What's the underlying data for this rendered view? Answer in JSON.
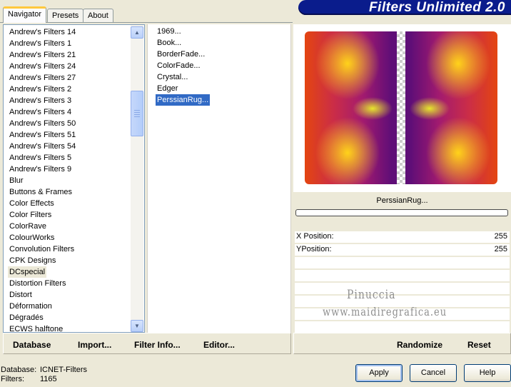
{
  "app": {
    "title": "Filters Unlimited 2.0",
    "colors": {
      "banner": "#0a1c8c",
      "selection": "#316ac5",
      "window_bg": "#ece9d8"
    }
  },
  "tabs": [
    {
      "label": "Navigator",
      "active": true
    },
    {
      "label": "Presets",
      "active": false
    },
    {
      "label": "About",
      "active": false
    }
  ],
  "categories": [
    "Andrew's Filters 14",
    "Andrew's Filters 1",
    "Andrew's Filters 21",
    "Andrew's Filters 24",
    "Andrew's Filters 27",
    "Andrew's Filters 2",
    "Andrew's Filters 3",
    "Andrew's Filters 4",
    "Andrew's Filters 50",
    "Andrew's Filters 51",
    "Andrew's Filters 54",
    "Andrew's Filters 5",
    "Andrew's Filters 9",
    "Blur",
    "Buttons & Frames",
    "Color Effects",
    "Color Filters",
    "ColorRave",
    "ColourWorks",
    "Convolution Filters",
    "CPK Designs",
    "DCspecial",
    "Distortion Filters",
    "Distort",
    "Déformation",
    "Dégradés",
    "ECWS halftone"
  ],
  "current_category": "DCspecial",
  "filters": [
    "1969...",
    "Book...",
    "BorderFade...",
    "ColorFade...",
    "Crystal...",
    "Edger",
    "PerssianRug..."
  ],
  "selected_filter": "PerssianRug...",
  "preview": {
    "filter_name": "PerssianRug...",
    "progress": 0
  },
  "params": [
    {
      "label": "X Position:",
      "value": "255"
    },
    {
      "label": "YPosition:",
      "value": "255"
    }
  ],
  "watermark": {
    "line1": "Pinuccia",
    "line2": "www.maidiregrafica.eu"
  },
  "toolbar": {
    "database": "Database",
    "import": "Import...",
    "filter_info": "Filter Info...",
    "editor": "Editor...",
    "randomize": "Randomize",
    "reset": "Reset"
  },
  "status": {
    "database_label": "Database:",
    "database_value": "ICNET-Filters",
    "filters_label": "Filters:",
    "filters_value": "1165"
  },
  "buttons": {
    "apply": "Apply",
    "cancel": "Cancel",
    "help": "Help"
  },
  "icons": [
    "scroll-up-icon",
    "scroll-down-icon"
  ]
}
